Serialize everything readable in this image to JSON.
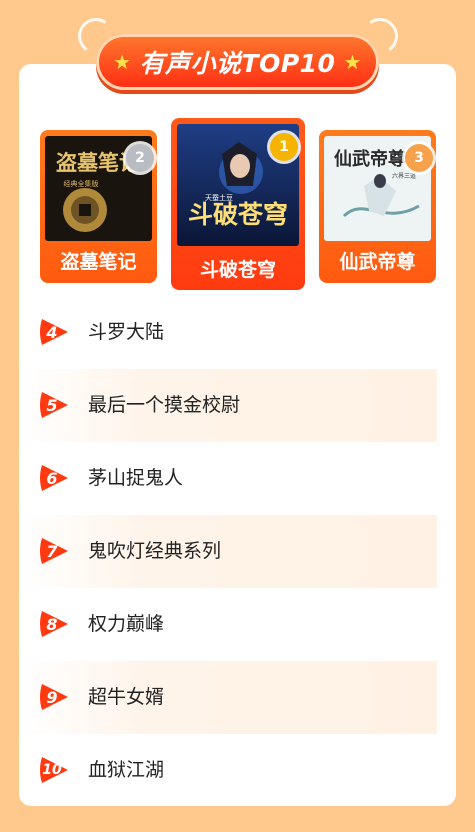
{
  "colors": {
    "page_bg": "#ffc98d",
    "card_bg": "#ffffff",
    "accent": "#ff3a10",
    "banner_gradient": [
      "#ff7a2d",
      "#ff2b14"
    ],
    "alt_row": "#fff1e4",
    "silver": "#b9bcc3",
    "gold": "#f5b400",
    "bronze": "#f7a24b"
  },
  "header": {
    "title": "有声小说TOP10",
    "star_icon": "star-icon"
  },
  "top3": [
    {
      "rank": "2",
      "title": "盗墓笔记",
      "cover_text": "盗墓笔记",
      "cover_subtext": "经典全集版"
    },
    {
      "rank": "1",
      "title": "斗破苍穹",
      "cover_text": "斗破苍穹",
      "cover_subtext": "天蚕土豆"
    },
    {
      "rank": "3",
      "title": "仙武帝尊",
      "cover_text": "仙武帝尊",
      "cover_subtext": "六界三道"
    }
  ],
  "list": [
    {
      "rank": "4",
      "title": "斗罗大陆"
    },
    {
      "rank": "5",
      "title": "最后一个摸金校尉"
    },
    {
      "rank": "6",
      "title": "茅山捉鬼人"
    },
    {
      "rank": "7",
      "title": "鬼吹灯经典系列"
    },
    {
      "rank": "8",
      "title": "权力巅峰"
    },
    {
      "rank": "9",
      "title": "超牛女婿"
    },
    {
      "rank": "10",
      "title": "血狱江湖"
    }
  ]
}
